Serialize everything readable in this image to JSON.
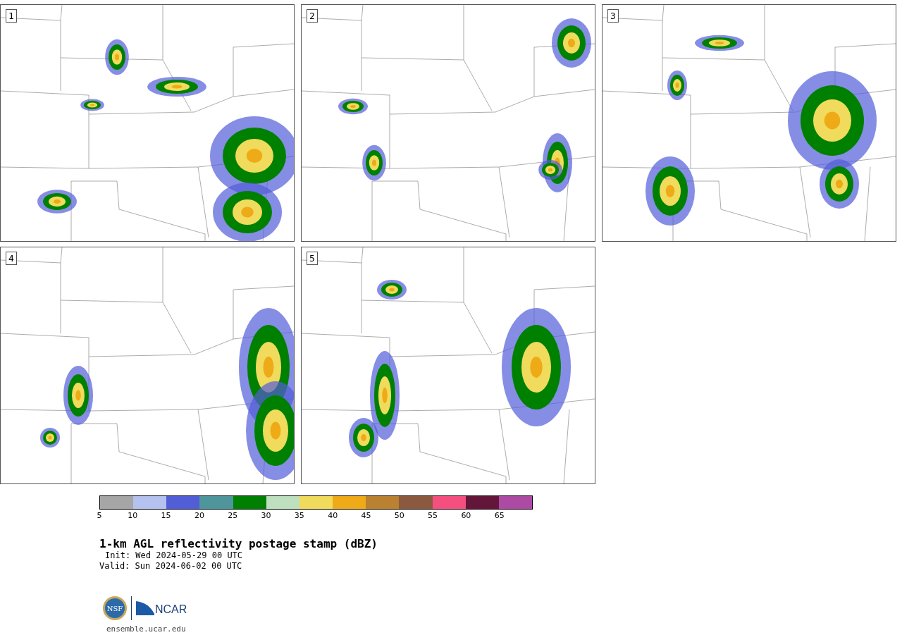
{
  "panels": [
    {
      "label": "1"
    },
    {
      "label": "2"
    },
    {
      "label": "3"
    },
    {
      "label": "4"
    },
    {
      "label": "5"
    }
  ],
  "colorbar": {
    "segments": [
      {
        "color": "#a6a6a6",
        "tick": "5"
      },
      {
        "color": "#b5c1ef",
        "tick": "10"
      },
      {
        "color": "#525dd8",
        "tick": "15"
      },
      {
        "color": "#4e969c",
        "tick": "20"
      },
      {
        "color": "#008000",
        "tick": "25"
      },
      {
        "color": "#bfe0bf",
        "tick": "30"
      },
      {
        "color": "#f0db5c",
        "tick": "35"
      },
      {
        "color": "#efaa17",
        "tick": "40"
      },
      {
        "color": "#ba8230",
        "tick": "45"
      },
      {
        "color": "#8b5a3e",
        "tick": "50"
      },
      {
        "color": "#f54f80",
        "tick": "55"
      },
      {
        "color": "#631639",
        "tick": "60"
      },
      {
        "color": "#ad4aa3",
        "tick": "65"
      }
    ]
  },
  "title": "1-km AGL reflectivity postage stamp (dBZ)",
  "init": "Init: Wed 2024-05-29 00 UTC",
  "valid": "Valid: Sun 2024-06-02 00 UTC",
  "logos": {
    "nsf": "NSF",
    "ncar": "NCAR"
  },
  "footer": "ensemble.ucar.edu"
}
